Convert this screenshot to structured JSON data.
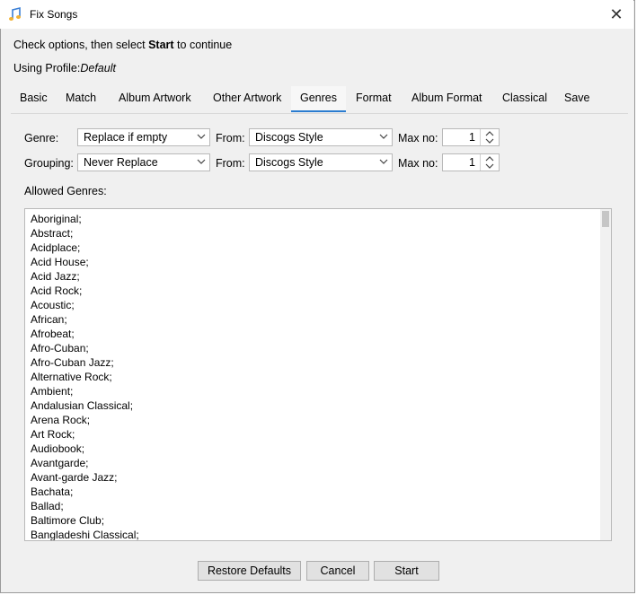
{
  "window": {
    "title": "Fix Songs",
    "app_icon": "music-note-icon",
    "close_icon": "close-icon",
    "close_glyph": "✕"
  },
  "instruction": {
    "before": "Check options, then select ",
    "bold": "Start",
    "after": " to continue"
  },
  "profile": {
    "label": "Using Profile:",
    "value": "Default"
  },
  "tabs": [
    {
      "label": "Basic",
      "active": false
    },
    {
      "label": "Match",
      "active": false
    },
    {
      "label": "Album Artwork",
      "active": false
    },
    {
      "label": "Other Artwork",
      "active": false
    },
    {
      "label": "Genres",
      "active": true
    },
    {
      "label": "Format",
      "active": false
    },
    {
      "label": "Album Format",
      "active": false
    },
    {
      "label": "Classical",
      "active": false
    },
    {
      "label": "Save",
      "active": false
    }
  ],
  "genre_row": {
    "label": "Genre:",
    "option": "Replace if empty",
    "from_label": "From:",
    "from_value": "Discogs Style",
    "max_label": "Max no:",
    "max_value": "1"
  },
  "grouping_row": {
    "label": "Grouping:",
    "option": "Never Replace",
    "from_label": "From:",
    "from_value": "Discogs Style",
    "max_label": "Max no:",
    "max_value": "1"
  },
  "allowed": {
    "label": "Allowed Genres:",
    "items": [
      "Aboriginal;",
      "Abstract;",
      "Acidplace;",
      "Acid House;",
      "Acid Jazz;",
      "Acid Rock;",
      "Acoustic;",
      "African;",
      "Afrobeat;",
      "Afro-Cuban;",
      "Afro-Cuban Jazz;",
      "Alternative Rock;",
      "Ambient;",
      "Andalusian Classical;",
      "Arena Rock;",
      "Art Rock;",
      "Audiobook;",
      "Avantgarde;",
      "Avant-garde Jazz;",
      "Bachata;",
      "Ballad;",
      "Baltimore Club;",
      "Bangladeshi Classical;"
    ]
  },
  "buttons": {
    "restore": "Restore Defaults",
    "cancel": "Cancel",
    "start": "Start"
  },
  "colors": {
    "accent": "#2a7cd0",
    "window_bg": "#f0f0f0",
    "button_bg": "#e1e1e1"
  }
}
